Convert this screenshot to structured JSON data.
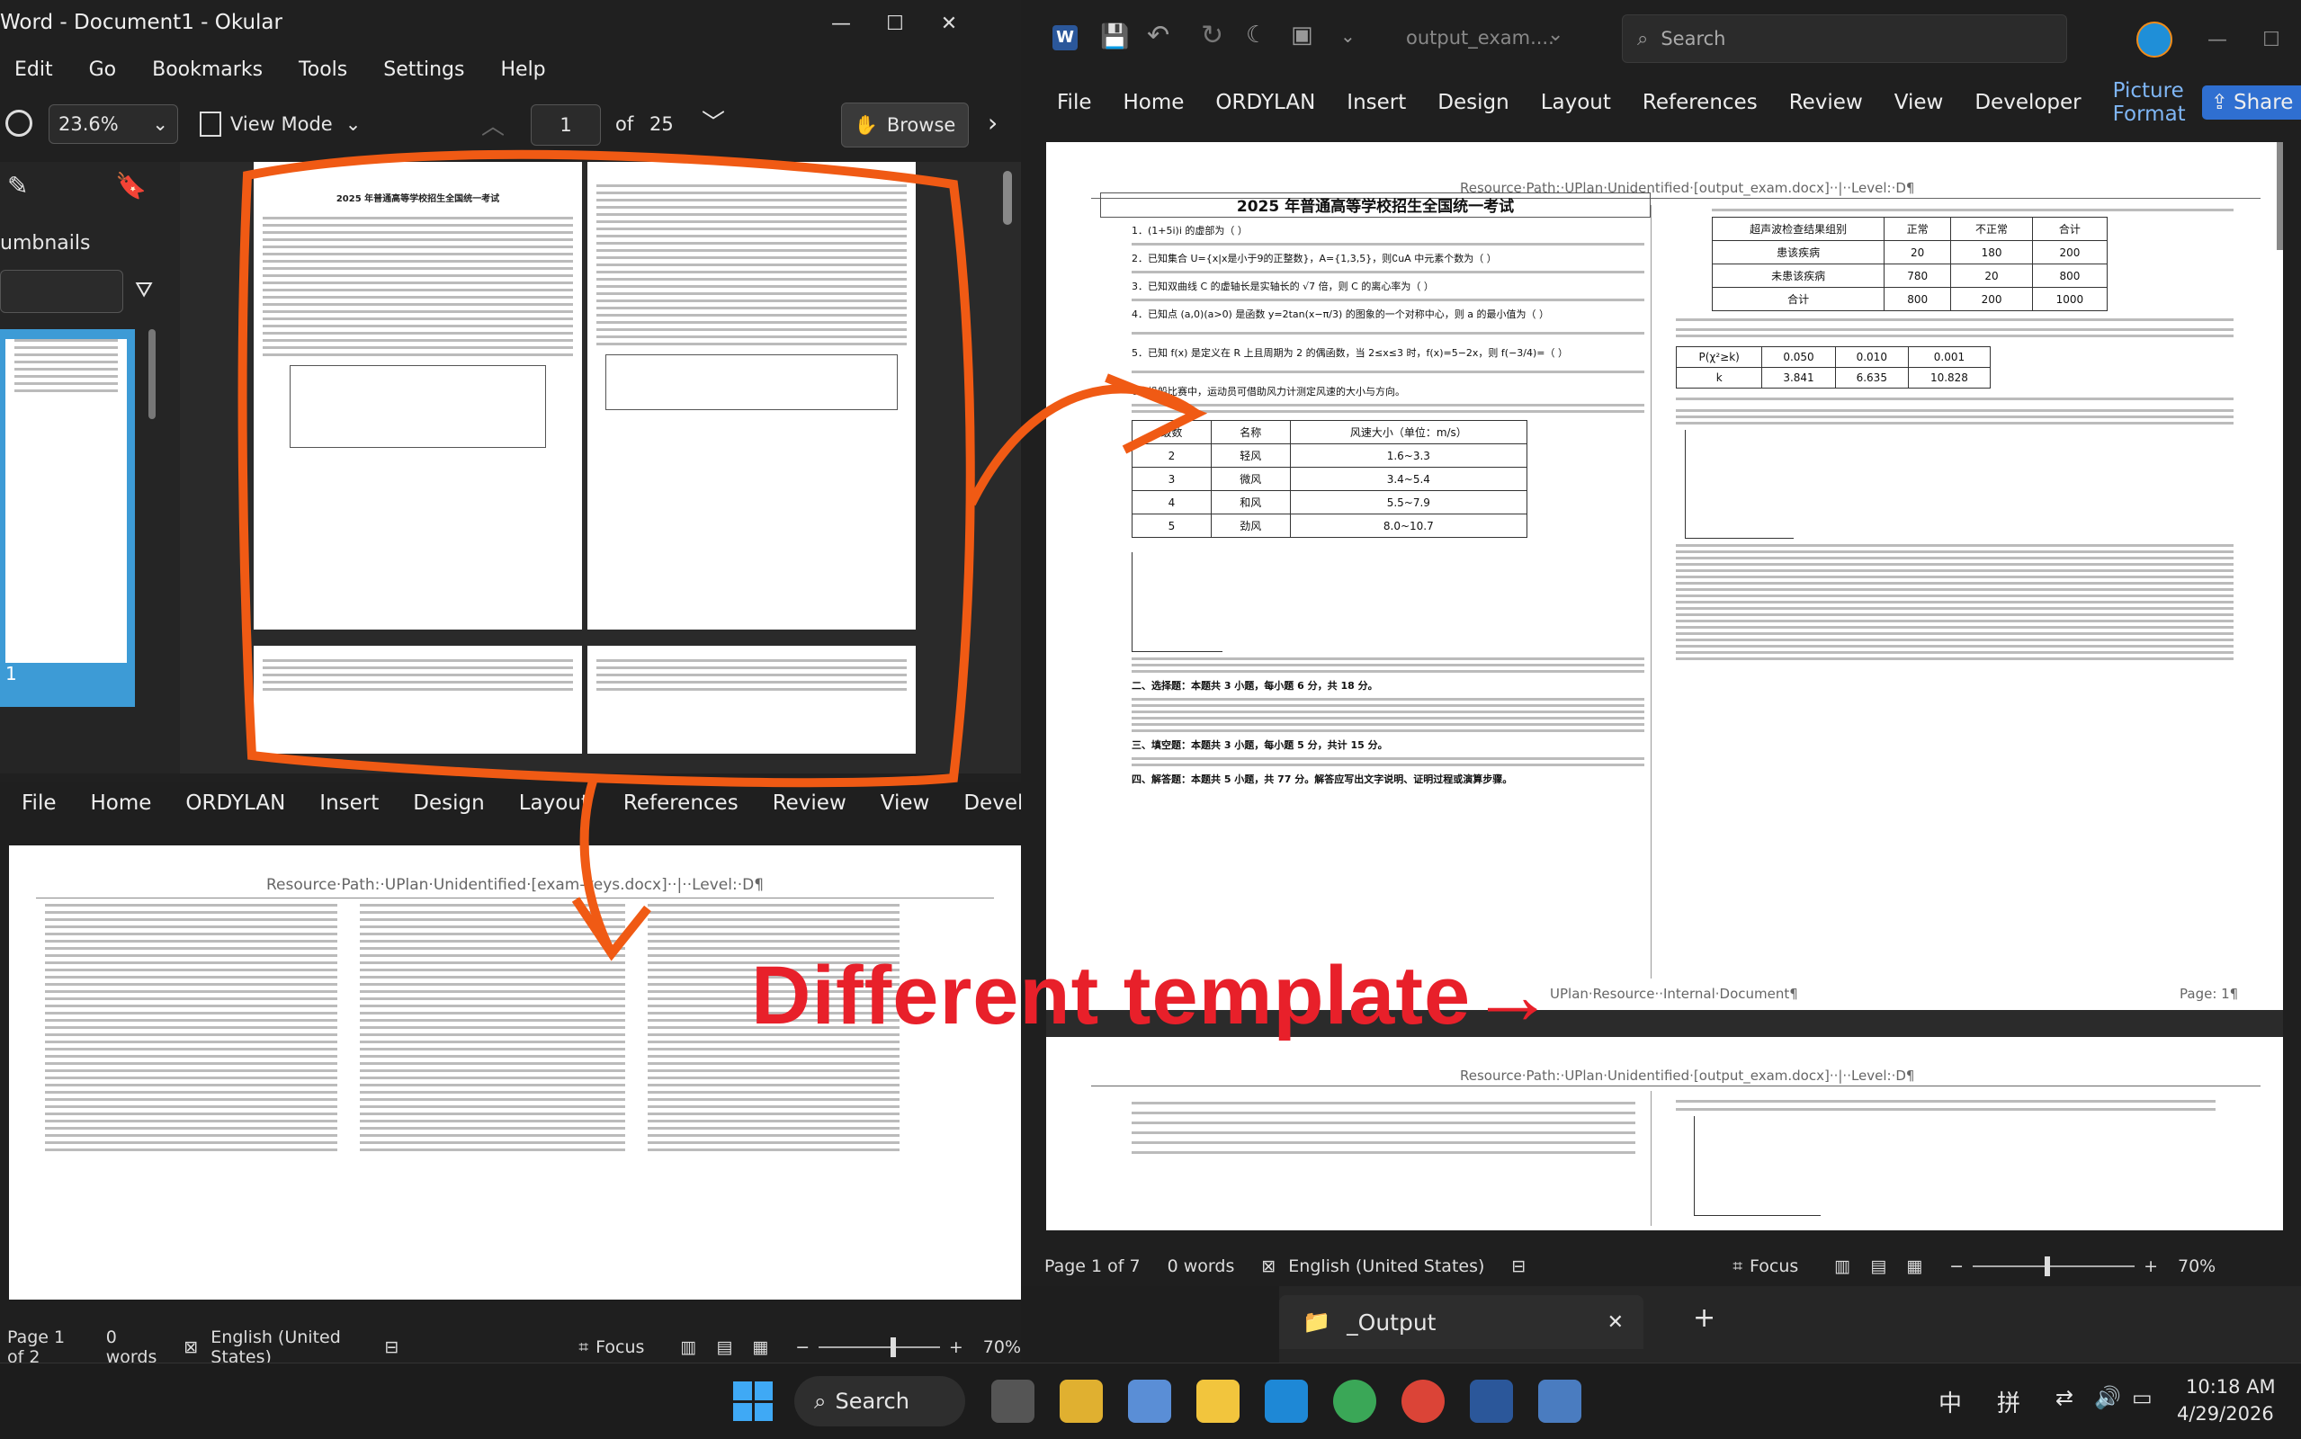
{
  "okular": {
    "title": "Word - Document1 - Okular",
    "menu": [
      "Edit",
      "Go",
      "Bookmarks",
      "Tools",
      "Settings",
      "Help"
    ],
    "zoom": "23.6%",
    "view_mode": "View Mode",
    "page_input": "1",
    "of_label": "of",
    "page_total": "25",
    "browse": "Browse",
    "sidebar_label": "umbnails",
    "thumb_number": "1",
    "page1_title": "2025 年普通高等学校招生全国统一考试"
  },
  "word_left": {
    "ribbon": [
      "File",
      "Home",
      "ORDYLAN",
      "Insert",
      "Design",
      "Layout",
      "References",
      "Review",
      "View",
      "Developer"
    ],
    "header": "Resource·Path:·UPlan·Unidentified·[exam-keys.docx]··|··Level:·D¶",
    "status": {
      "page": "Page 1 of 2",
      "words": "0 words",
      "language": "English (United States)",
      "focus": "Focus",
      "zoom": "70%"
    }
  },
  "word_right": {
    "filename": "output_exam....",
    "search_placeholder": "Search",
    "ribbon": [
      "File",
      "Home",
      "ORDYLAN",
      "Insert",
      "Design",
      "Layout",
      "References",
      "Review",
      "View",
      "Developer",
      "Picture Format"
    ],
    "share": "Share",
    "header": "Resource·Path:·UPlan·Unidentified·[output_exam.docx]··|··Level:·D¶",
    "doc_title": "2025 年普通高等学校招生全国统一考试",
    "footer_center": "UPlan·Resource··Internal·Document¶",
    "footer_right": "Page: 1¶",
    "wind_table": {
      "headers": [
        "级数",
        "名称",
        "风速大小（单位：m/s）"
      ],
      "rows": [
        [
          "2",
          "轻风",
          "1.6~3.3"
        ],
        [
          "3",
          "微风",
          "3.4~5.4"
        ],
        [
          "4",
          "和风",
          "5.5~7.9"
        ],
        [
          "5",
          "劲风",
          "8.0~10.7"
        ]
      ]
    },
    "disease_table": {
      "headers": [
        "超声波检查结果组别",
        "正常",
        "不正常",
        "合计"
      ],
      "rows": [
        [
          "患该疾病",
          "20",
          "180",
          "200"
        ],
        [
          "未患该疾病",
          "780",
          "20",
          "800"
        ],
        [
          "合计",
          "800",
          "200",
          "1000"
        ]
      ]
    },
    "chi_table": {
      "row1": [
        "P(χ²≥k)",
        "0.050",
        "0.010",
        "0.001"
      ],
      "row2": [
        "k",
        "3.841",
        "6.635",
        "10.828"
      ]
    },
    "lines": [
      "1．(1+5i)i 的虚部为（ ）",
      "2．已知集合 U={x|x是小于9的正整数}，A={1,3,5}，则∁uA 中元素个数为（ ）",
      "3．已知双曲线 C 的虚轴长是实轴长的 √7 倍，则 C 的离心率为（ ）",
      "4．已知点 (a,0)(a>0) 是函数 y=2tan(x−π/3) 的图象的一个对称中心，则 a 的最小值为（ ）",
      "5．已知 f(x) 是定义在 R 上且周期为 2 的偶函数，当 2≤x≤3 时，f(x)=5−2x，则 f(−3/4)=（ ）",
      "6．帆船比赛中，运动员可借助风力计测定风速的大小与方向。",
      "二、选择题：本题共 3 小题，每小题 6 分，共 18 分。",
      "三、填空题：本题共 3 小题，每小题 5 分，共计 15 分。",
      "四、解答题：本题共 5 小题，共 77 分。解答应写出文字说明、证明过程或演算步骤。"
    ],
    "status": {
      "page": "Page 1 of 7",
      "words": "0 words",
      "language": "English (United States)",
      "focus": "Focus",
      "zoom": "70%"
    }
  },
  "explorer": {
    "tab": "_Output"
  },
  "taskbar": {
    "search": "Search",
    "ime1": "中",
    "ime2": "拼",
    "time": "10:18 AM",
    "date": "4/29/2026"
  },
  "annotation": {
    "text": "Different template→",
    "color": "#e8202a"
  }
}
